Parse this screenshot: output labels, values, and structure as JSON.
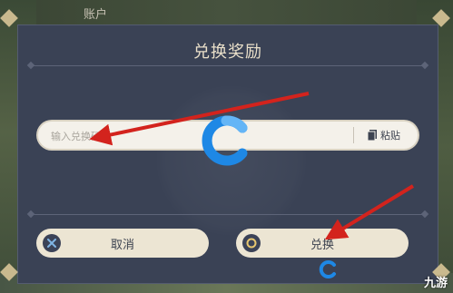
{
  "header": {
    "account_tab": "账户"
  },
  "dialog": {
    "title": "兑换奖励",
    "code_input": {
      "placeholder": "输入兑换码",
      "value": ""
    },
    "paste_label": "粘贴",
    "cancel_label": "取消",
    "confirm_label": "兑换"
  },
  "watermark": {
    "brand_text": "九游"
  },
  "colors": {
    "dialog_bg": "#3a4255",
    "button_bg": "#ece5d3",
    "title_text": "#e9dfc9",
    "arrow": "#d3231d",
    "logo_blue": "#1e88e5"
  },
  "icons": {
    "paste": "document-icon",
    "cancel": "x-icon",
    "confirm": "circle-icon",
    "watermark": "c-logo-icon"
  }
}
